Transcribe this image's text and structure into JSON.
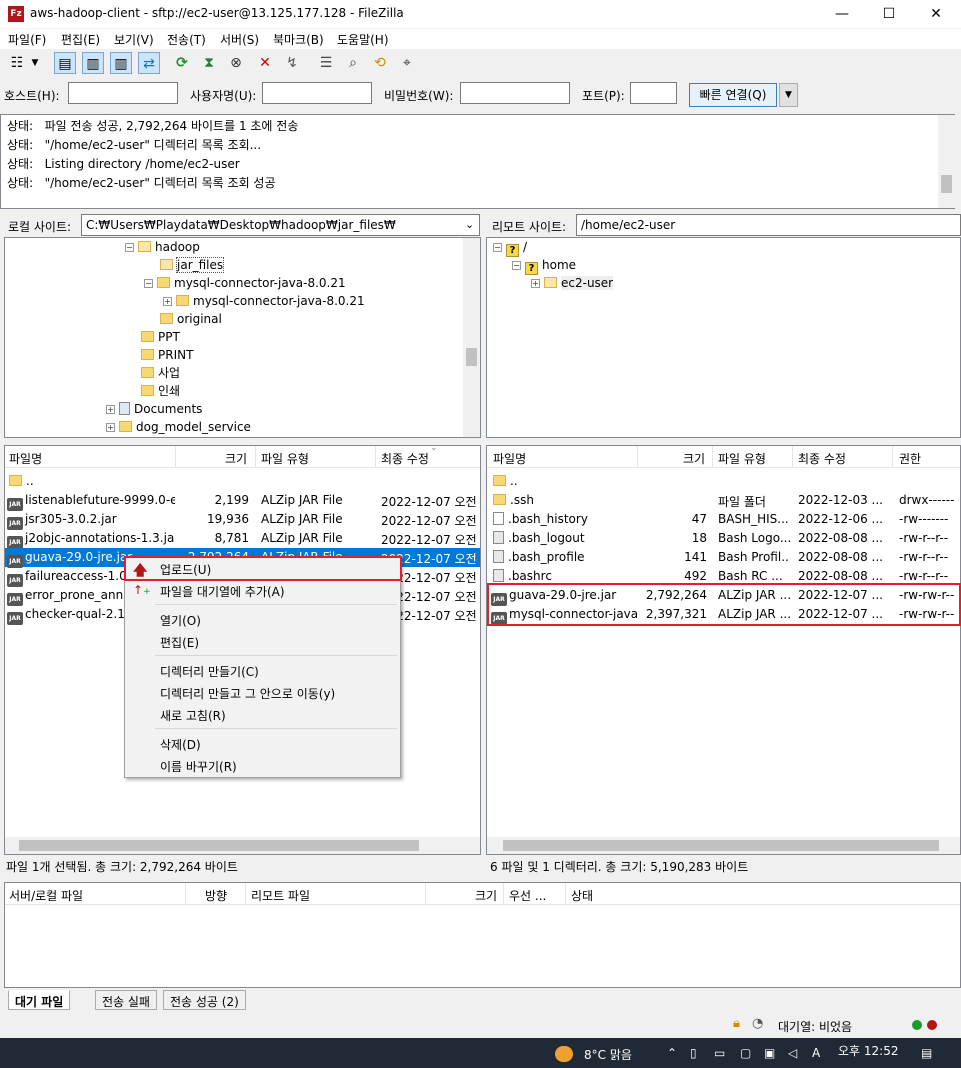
{
  "window": {
    "title": "aws-hadoop-client - sftp://ec2-user@13.125.177.128 - FileZilla",
    "controls": {
      "minimize": "—",
      "maximize": "☐",
      "close": "✕"
    }
  },
  "menu": [
    "파일(F)",
    "편집(E)",
    "보기(V)",
    "전송(T)",
    "서버(S)",
    "북마크(B)",
    "도움말(H)"
  ],
  "quickconnect": {
    "host_label": "호스트(H):",
    "user_label": "사용자명(U):",
    "pass_label": "비밀번호(W):",
    "port_label": "포트(P):",
    "connect_label": "빠른 연결(Q)"
  },
  "log": [
    {
      "prefix": "상태:",
      "text": "파일 전송 성공, 2,792,264 바이트를 1 초에 전송"
    },
    {
      "prefix": "상태:",
      "text": "\"/home/ec2-user\" 디렉터리 목록 조회..."
    },
    {
      "prefix": "상태:",
      "text": "Listing directory /home/ec2-user"
    },
    {
      "prefix": "상태:",
      "text": "\"/home/ec2-user\" 디렉터리 목록 조회 성공"
    }
  ],
  "local": {
    "site_label": "로컬 사이트:",
    "path": "C:₩Users₩Playdata₩Desktop₩hadoop₩jar_files₩",
    "tree": [
      {
        "label": "hadoop",
        "pm": "−"
      },
      {
        "label": "jar_files",
        "pm": ""
      },
      {
        "label": "mysql-connector-java-8.0.21",
        "pm": "−"
      },
      {
        "label": "mysql-connector-java-8.0.21",
        "pm": "+"
      },
      {
        "label": "original",
        "pm": ""
      },
      {
        "label": "PPT",
        "pm": ""
      },
      {
        "label": "PRINT",
        "pm": ""
      },
      {
        "label": "사업",
        "pm": ""
      },
      {
        "label": "인쇄",
        "pm": ""
      },
      {
        "label": "Documents",
        "pm": "+"
      },
      {
        "label": "dog_model_service",
        "pm": "+"
      }
    ],
    "columns": [
      "파일명",
      "크기",
      "파일 유형",
      "최종 수정"
    ],
    "files": [
      {
        "name": "..",
        "size": "",
        "type": "",
        "modified": ""
      },
      {
        "name": "listenablefuture-9999.0-e...",
        "size": "2,199",
        "type": "ALZip JAR File",
        "modified": "2022-12-07 오전"
      },
      {
        "name": "jsr305-3.0.2.jar",
        "size": "19,936",
        "type": "ALZip JAR File",
        "modified": "2022-12-07 오전"
      },
      {
        "name": "j2objc-annotations-1.3.jar",
        "size": "8,781",
        "type": "ALZip JAR File",
        "modified": "2022-12-07 오전"
      },
      {
        "name": "guava-29.0-jre.jar",
        "size": "2,792,264",
        "type": "ALZip JAR File",
        "modified": "2022-12-07 오전"
      },
      {
        "name": "failureaccess-1.0.1",
        "size": "",
        "type": "",
        "modified": "2022-12-07 오전"
      },
      {
        "name": "error_prone_annot",
        "size": "",
        "type": "",
        "modified": "2022-12-07 오전"
      },
      {
        "name": "checker-qual-2.11",
        "size": "",
        "type": "",
        "modified": "2022-12-07 오전"
      }
    ],
    "status": "파일 1개 선택됨. 총 크기: 2,792,264 바이트"
  },
  "remote": {
    "site_label": "리모트 사이트:",
    "path": "/home/ec2-user",
    "tree": [
      {
        "label": "/",
        "pm": "−"
      },
      {
        "label": "home",
        "pm": "−"
      },
      {
        "label": "ec2-user",
        "pm": "+"
      }
    ],
    "columns": [
      "파일명",
      "크기",
      "파일 유형",
      "최종 수정",
      "권한"
    ],
    "files": [
      {
        "name": "..",
        "size": "",
        "type": "",
        "modified": "",
        "perm": ""
      },
      {
        "name": ".ssh",
        "size": "",
        "type": "파일 폴더",
        "modified": "2022-12-03 ...",
        "perm": "drwx------"
      },
      {
        "name": ".bash_history",
        "size": "47",
        "type": "BASH_HIS...",
        "modified": "2022-12-06 ...",
        "perm": "-rw-------"
      },
      {
        "name": ".bash_logout",
        "size": "18",
        "type": "Bash Logo...",
        "modified": "2022-08-08 ...",
        "perm": "-rw-r--r--"
      },
      {
        "name": ".bash_profile",
        "size": "141",
        "type": "Bash Profil...",
        "modified": "2022-08-08 ...",
        "perm": "-rw-r--r--"
      },
      {
        "name": ".bashrc",
        "size": "492",
        "type": "Bash RC ...",
        "modified": "2022-08-08 ...",
        "perm": "-rw-r--r--"
      },
      {
        "name": "guava-29.0-jre.jar",
        "size": "2,792,264",
        "type": "ALZip JAR ...",
        "modified": "2022-12-07 ...",
        "perm": "-rw-rw-r--"
      },
      {
        "name": "mysql-connector-java...",
        "size": "2,397,321",
        "type": "ALZip JAR ...",
        "modified": "2022-12-07 ...",
        "perm": "-rw-rw-r--"
      }
    ],
    "status": "6 파일 및 1 디렉터리. 총 크기: 5,190,283 바이트"
  },
  "context_menu": {
    "upload": "업로드(U)",
    "add_queue": "파일을 대기열에 추가(A)",
    "open": "열기(O)",
    "edit": "편집(E)",
    "mkdir": "디렉터리 만들기(C)",
    "mkdir_enter": "디렉터리 만들고 그 안으로 이동(y)",
    "refresh": "새로 고침(R)",
    "delete": "삭제(D)",
    "rename": "이름 바꾸기(R)"
  },
  "queue": {
    "columns": [
      "서버/로컬 파일",
      "방향",
      "리모트 파일",
      "크기",
      "우선 ...",
      "상태"
    ],
    "tabs": [
      "대기 파일",
      "전송 실패",
      "전송 성공 (2)"
    ],
    "status": "대기열: 비었음"
  },
  "taskbar": {
    "weather": "8°C  맑음",
    "clock": "오후 12:52"
  },
  "colors": {
    "selection": "#0078d7",
    "highlight_box": "#e0202a"
  }
}
